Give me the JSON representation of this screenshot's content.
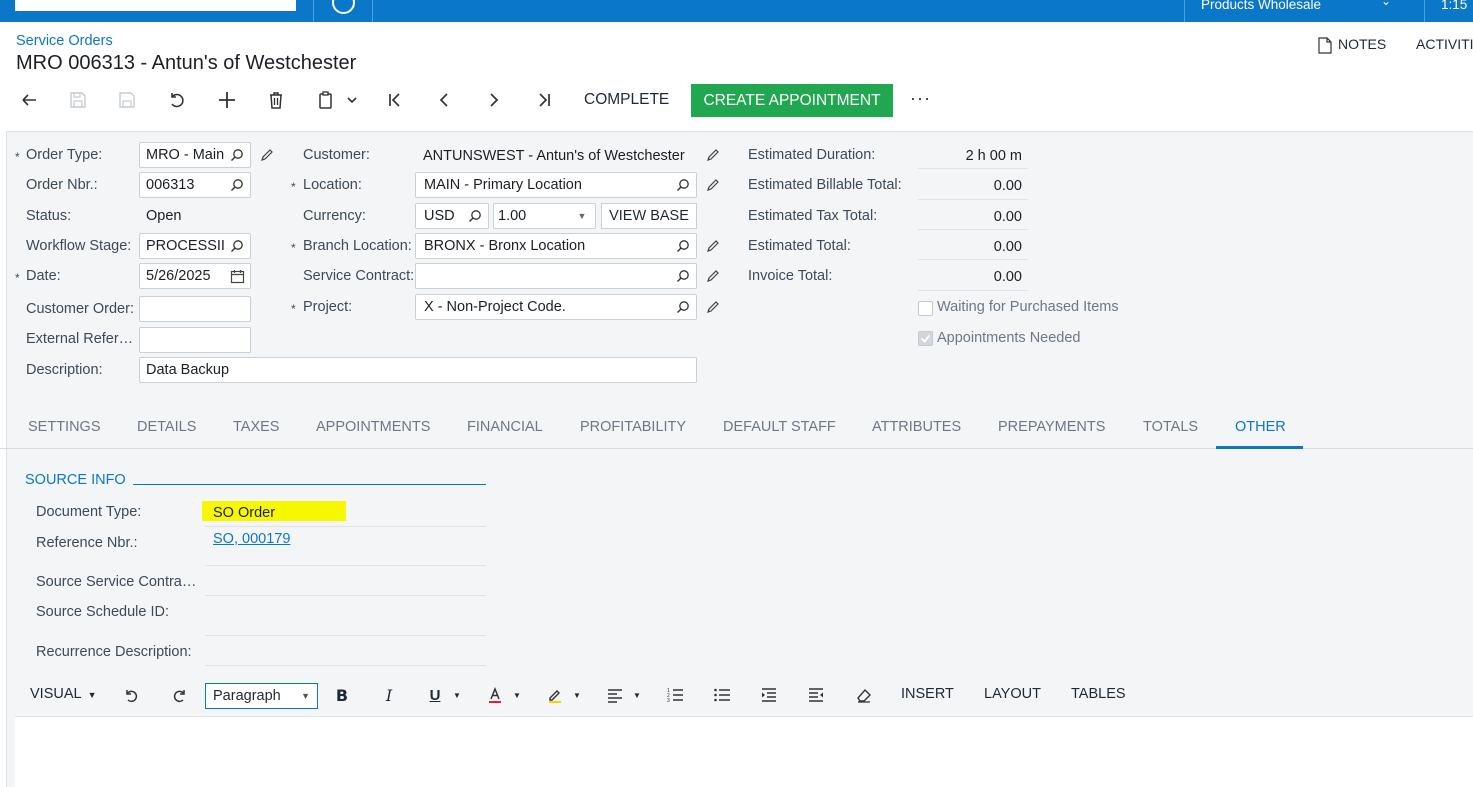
{
  "topbar": {
    "company": "Products Wholesale",
    "time": "1:15"
  },
  "header": {
    "breadcrumb": "Service Orders",
    "title": "MRO 006313 - Antun's of Westchester",
    "notes": "NOTES",
    "activities": "ACTIVITI"
  },
  "toolbar": {
    "complete": "COMPLETE",
    "create_appointment": "CREATE APPOINTMENT",
    "more": "···"
  },
  "form": {
    "order_type_label": "Order Type:",
    "order_type": "MRO - Main",
    "order_nbr_label": "Order Nbr.:",
    "order_nbr": "006313",
    "status_label": "Status:",
    "status": "Open",
    "workflow_stage_label": "Workflow Stage:",
    "workflow_stage": "PROCESSII",
    "date_label": "Date:",
    "date": "5/26/2025",
    "customer_order_label": "Customer Order:",
    "customer_order": "",
    "external_ref_label": "External Refer…",
    "external_ref": "",
    "description_label": "Description:",
    "description": "Data Backup",
    "customer_label": "Customer:",
    "customer": "ANTUNSWEST - Antun's of Westchester",
    "location_label": "Location:",
    "location": "MAIN - Primary Location",
    "currency_label": "Currency:",
    "currency": "USD",
    "rate": "1.00",
    "view_base": "VIEW BASE",
    "branch_location_label": "Branch Location:",
    "branch_location": "BRONX - Bronx Location",
    "service_contract_label": "Service Contract:",
    "service_contract": "",
    "project_label": "Project:",
    "project": "X - Non-Project Code.",
    "est_duration_label": "Estimated Duration:",
    "est_duration": "2 h 00 m",
    "est_billable_label": "Estimated Billable Total:",
    "est_billable": "0.00",
    "est_tax_label": "Estimated Tax Total:",
    "est_tax": "0.00",
    "est_total_label": "Estimated Total:",
    "est_total": "0.00",
    "invoice_total_label": "Invoice Total:",
    "invoice_total": "0.00",
    "waiting_label": "Waiting for Purchased Items",
    "waiting_checked": false,
    "appointments_needed_label": "Appointments Needed",
    "appointments_needed_checked": true
  },
  "tabs": [
    {
      "label": "SETTINGS"
    },
    {
      "label": "DETAILS"
    },
    {
      "label": "TAXES"
    },
    {
      "label": "APPOINTMENTS"
    },
    {
      "label": "FINANCIAL"
    },
    {
      "label": "PROFITABILITY"
    },
    {
      "label": "DEFAULT STAFF"
    },
    {
      "label": "ATTRIBUTES"
    },
    {
      "label": "PREPAYMENTS"
    },
    {
      "label": "TOTALS"
    },
    {
      "label": "OTHER",
      "active": true
    }
  ],
  "source_info": {
    "title": "SOURCE INFO",
    "document_type_label": "Document Type:",
    "document_type": "SO Order",
    "reference_nbr_label": "Reference Nbr.:",
    "reference_nbr": "SO, 000179",
    "source_service_contract_label": "Source Service Contra…",
    "source_schedule_id_label": "Source Schedule ID:",
    "recurrence_description_label": "Recurrence Description:"
  },
  "editor": {
    "mode": "VISUAL",
    "paragraph": "Paragraph",
    "insert": "INSERT",
    "layout": "LAYOUT",
    "tables": "TABLES"
  },
  "colors": {
    "brand_blue": "#0b77c8",
    "create_green": "#21a750",
    "highlight_yellow": "#f7f700"
  }
}
